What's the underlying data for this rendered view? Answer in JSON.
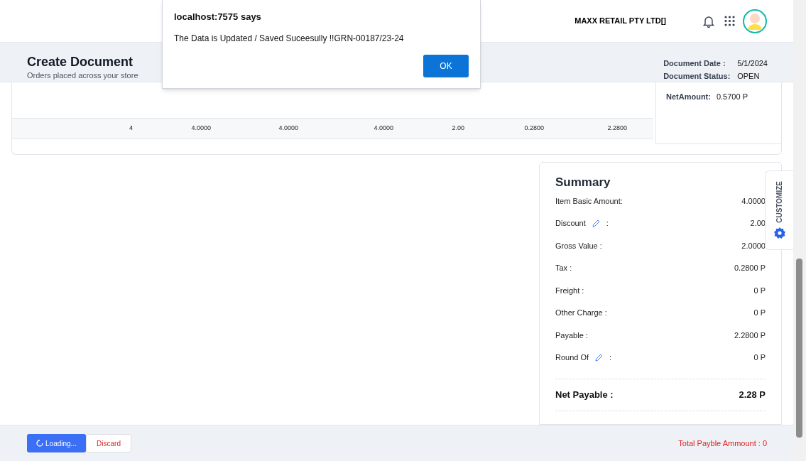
{
  "header": {
    "company": "MAXX RETAIL PTY LTD[]"
  },
  "page": {
    "title": "Create Document",
    "subtitle": "Orders placed across your store",
    "meta": [
      {
        "label": "Document Date :",
        "value": "5/1/2024"
      },
      {
        "label": "Document Status:",
        "value": "OPEN"
      }
    ]
  },
  "table": {
    "row": [
      "4",
      "4.0000",
      "4.0000",
      "4.0000",
      "2.00",
      "0.2800",
      "2.2800"
    ]
  },
  "totals_box": {
    "label": "NetAmount:",
    "value": "0.5700 P"
  },
  "summary": {
    "title": "Summary",
    "rows": [
      {
        "label": "Item Basic Amount:",
        "value": "4.0000",
        "editable": false
      },
      {
        "label": "Discount",
        "value": "2.00",
        "editable": true,
        "suffix": ":"
      },
      {
        "label": "Gross Value :",
        "value": "2.0000",
        "editable": false
      },
      {
        "label": "Tax :",
        "value": "0.2800 P",
        "editable": false
      },
      {
        "label": "Freight :",
        "value": "0 P",
        "editable": false
      },
      {
        "label": "Other Charge :",
        "value": "0 P",
        "editable": false
      },
      {
        "label": "Payable :",
        "value": "2.2800 P",
        "editable": false
      },
      {
        "label": "Round Of",
        "value": "0 P",
        "editable": true,
        "suffix": ":"
      }
    ],
    "net": {
      "label": "Net Payable :",
      "value": "2.28 P"
    }
  },
  "customize_tab": {
    "label": "CUSTOMIZE"
  },
  "footer": {
    "buttons": [
      {
        "kind": "primary",
        "label": "Loading..."
      },
      {
        "kind": "secondary",
        "label": "Discard"
      }
    ],
    "total": "Total Payble Ammount : 0"
  },
  "dialog": {
    "title": "localhost:7575 says",
    "message": "The Data is Updated / Saved Suceesully !!GRN-00187/23-24",
    "button": "OK"
  }
}
